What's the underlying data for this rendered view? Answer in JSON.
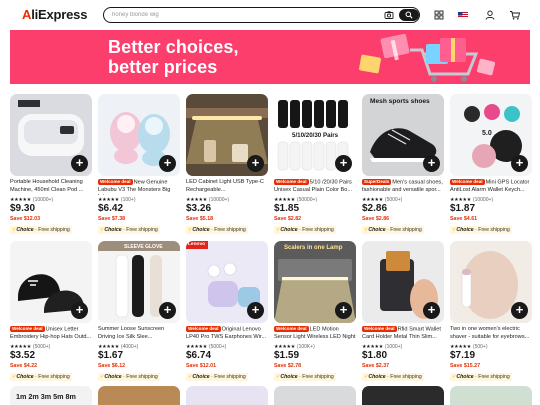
{
  "header": {
    "logo": "AliExpress",
    "search_placeholder": "honey blonde wig",
    "icons": [
      "camera-icon",
      "search-icon",
      "grid-icon",
      "flag-icon",
      "user-icon",
      "cart-icon"
    ]
  },
  "banner": {
    "line1": "Better choices,",
    "line2": "better prices",
    "color": "#fb3e6c"
  },
  "products": [
    {
      "badge": "",
      "title": "Portable Household Cleaning Machine, 450ml Clean Pod ...",
      "stars": "★★★★★",
      "count": "(10000+)",
      "price": "$9.30",
      "save": "Save $12.03",
      "choice": "Choice",
      "shipping": "Free shipping",
      "thumb_label": ""
    },
    {
      "badge": "Welcome deal",
      "title": "New Genuine Labubu V3 The Monsters Big Int...",
      "stars": "★★★★★",
      "count": "(100+)",
      "price": "$6.42",
      "save": "Save $7.38",
      "choice": "Choice",
      "shipping": "Free shipping",
      "thumb_label": ""
    },
    {
      "badge": "",
      "title": "LED Cabinet Light USB Type-C Rechargeable...",
      "stars": "★★★★★",
      "count": "(10000+)",
      "price": "$3.26",
      "save": "Save $5.18",
      "choice": "Choice",
      "shipping": "Free shipping",
      "thumb_label": ""
    },
    {
      "badge": "Welcome deal",
      "title": "5/10 /20/30 Pairs Unisex Casual Plain Color Bo...",
      "stars": "★★★★★",
      "count": "(50000+)",
      "price": "$1.85",
      "save": "Save $2.82",
      "choice": "Choice",
      "shipping": "Free shipping",
      "thumb_label": "5/10/20/30 Pairs"
    },
    {
      "badge": "SuperDeals",
      "title": "Men's casual shoes, fashionable and versatile spor...",
      "stars": "★★★★★",
      "count": "(5000+)",
      "price": "$2.86",
      "save": "Save $2.86",
      "choice": "Choice",
      "shipping": "Free shipping",
      "thumb_label": "Mesh sports shoes"
    },
    {
      "badge": "Welcome deal",
      "title": "Mini GPS Locator AntiLost Alarm Wallet Keych...",
      "stars": "★★★★★",
      "count": "(10000+)",
      "price": "$1.87",
      "save": "Save $4.61",
      "choice": "Choice",
      "shipping": "Free shipping",
      "thumb_label": "5.0"
    },
    {
      "badge": "Welcome deal",
      "title": "Unisex Letter Embroidery Hip-hop Hats Outd...",
      "stars": "★★★★★",
      "count": "(5000+)",
      "price": "$3.52",
      "save": "Save $4.22",
      "choice": "Choice",
      "shipping": "Free shipping",
      "thumb_label": ""
    },
    {
      "badge": "",
      "title": "Summer Loose Sunscreen Driving Ice Silk Slee...",
      "stars": "★★★★★",
      "count": "(4000+)",
      "price": "$1.67",
      "save": "Save $6.12",
      "choice": "Choice",
      "shipping": "Free shipping",
      "thumb_label": "SLEEVE GLOVE"
    },
    {
      "badge": "Welcome deal",
      "title": "Original Lenovo LP40 Pro TWS Earphones Wir...",
      "stars": "★★★★★",
      "count": "(5000+)",
      "price": "$6.74",
      "save": "Save $12.01",
      "choice": "Choice",
      "shipping": "Free shipping",
      "thumb_label": "Lenovo"
    },
    {
      "badge": "Welcome deal",
      "title": "LED Motion Sensor Light Wireless LED Night ...",
      "stars": "★★★★★",
      "count": "(100K+)",
      "price": "$1.59",
      "save": "Save $2.78",
      "choice": "Choice",
      "shipping": "Free shipping",
      "thumb_label": "Scalers in one Lamp"
    },
    {
      "badge": "Welcome deal",
      "title": "Rfid Smart Wallet Card Holder Metal Thin Slim...",
      "stars": "★★★★★",
      "count": "(1000+)",
      "price": "$1.80",
      "save": "Save $2.37",
      "choice": "Choice",
      "shipping": "Free shipping",
      "thumb_label": ""
    },
    {
      "badge": "",
      "title": "Two in one women's electric shaver - suitable for eyebrows...",
      "stars": "★★★★★",
      "count": "(500+)",
      "price": "$7.19",
      "save": "Save $15.27",
      "choice": "Choice",
      "shipping": "Free shipping",
      "thumb_label": ""
    }
  ],
  "row3": {
    "first_label": "1m 2m 3m 5m 8m"
  }
}
